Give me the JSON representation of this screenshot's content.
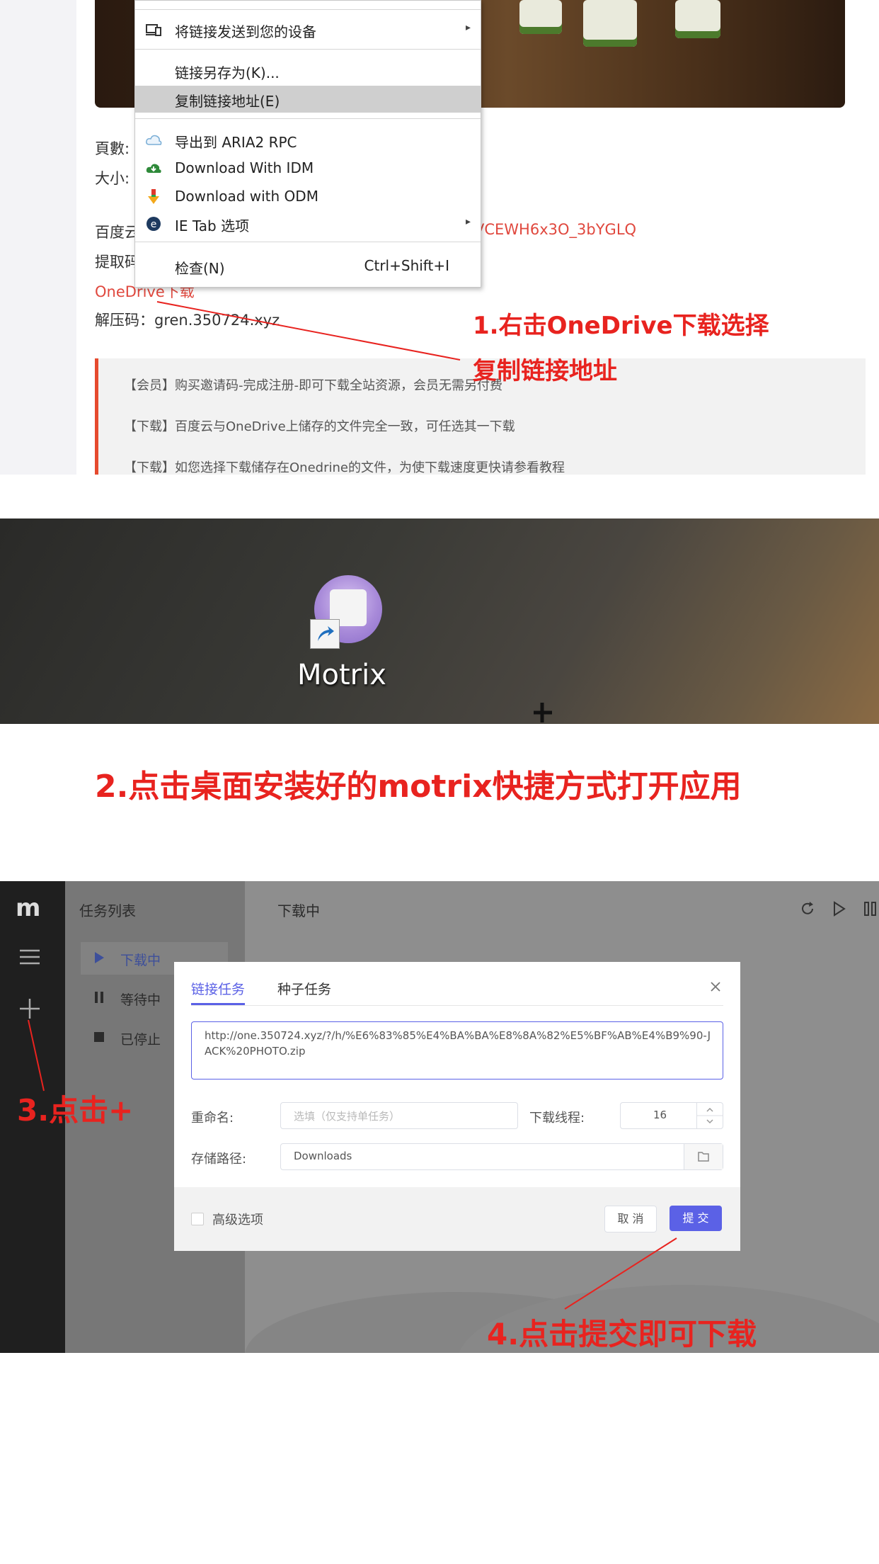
{
  "browser": {
    "info_lines": {
      "pages_label": "頁數:",
      "size_label": "大小:",
      "baidu_label": "百度云",
      "baidu_link_fragment": "VCEWH6x3O_3bYGLQ",
      "extract_label": "提取码",
      "onedrive_link": "OneDrive下载",
      "unzip_code": "解压码：gren.350724.xyz"
    },
    "notices": [
      "【会员】购买邀请码-完成注册-即可下载全站资源，会员无需另付费",
      "【下载】百度云与OneDrive上储存的文件完全一致，可任选其一下载",
      "【下载】如您选择下载储存在Onedrine的文件，为使下载速度更快请参看教程"
    ]
  },
  "context_menu": {
    "items": [
      {
        "label": "将链接发送到您的设备",
        "icon": "devices-icon",
        "submenu": "▸"
      },
      {
        "label": "链接另存为(K)..."
      },
      {
        "label": "复制链接地址(E)",
        "highlighted": true
      },
      {
        "label": "导出到 ARIA2 RPC",
        "icon": "aria2-cloud-icon"
      },
      {
        "label": "Download With IDM",
        "icon": "idm-cloud-icon"
      },
      {
        "label": "Download with ODM",
        "icon": "odm-arrow-icon"
      },
      {
        "label": "IE Tab 选项",
        "icon": "ietab-icon",
        "submenu": "▸"
      },
      {
        "label": "检查(N)",
        "shortcut": "Ctrl+Shift+I"
      }
    ]
  },
  "annotations": {
    "step1_line1": "1.右击OneDrive下载选择",
    "step1_line2": "复制链接地址",
    "step2": "2.点击桌面安装好的motrix快捷方式打开应用",
    "step3": "3.点击+",
    "step4": "4.点击提交即可下载",
    "color": "#e8231f"
  },
  "desktop": {
    "icon_label": "Motrix",
    "icon": "motrix-app-icon"
  },
  "motrix": {
    "rail_logo": "m",
    "sidebar_title": "任务列表",
    "sidebar_items": [
      {
        "label": "下载中",
        "icon": "play-icon",
        "active": true
      },
      {
        "label": "等待中",
        "icon": "pause-icon"
      },
      {
        "label": "已停止",
        "icon": "stop-icon"
      }
    ],
    "main_title": "下载中",
    "dialog": {
      "tabs": [
        "链接任务",
        "种子任务"
      ],
      "url": "http://one.350724.xyz/?/h/%E6%83%85%E4%BA%BA%E8%8A%82%E5%BF%AB%E4%B9%90-JACK%20PHOTO.zip",
      "rename_label": "重命名:",
      "rename_placeholder": "选填（仅支持单任务）",
      "threads_label": "下载线程:",
      "threads_value": "16",
      "path_label": "存储路径:",
      "path_value": "Downloads",
      "advanced_label": "高级选项",
      "cancel_label": "取 消",
      "submit_label": "提 交",
      "accent": "#5b61e6"
    }
  }
}
